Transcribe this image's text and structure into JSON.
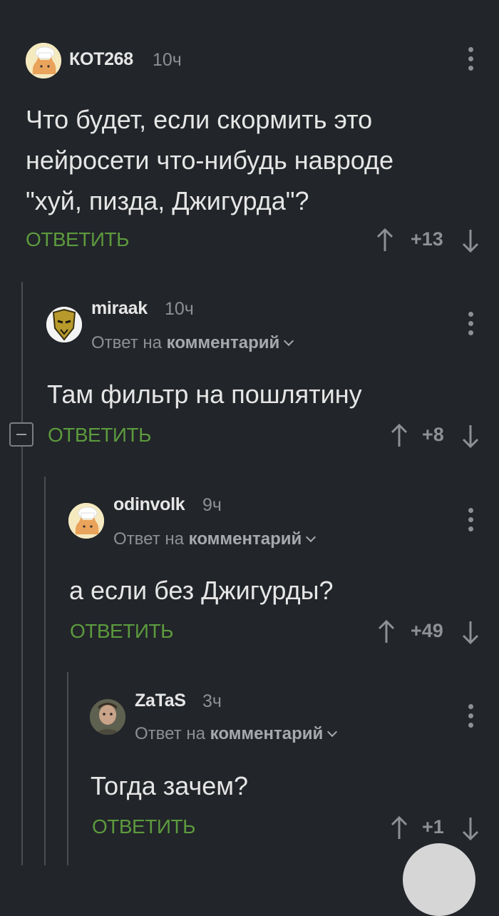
{
  "colors": {
    "background": "#222529",
    "reply_action": "#5c9a3e",
    "muted": "#8d9095",
    "thread_line": "#4a4d52"
  },
  "comments": [
    {
      "username": "КОТ268",
      "time": "10ч",
      "avatar_icon": "cat-chef-avatar-icon",
      "text": "Что будет, если скормить это\nнейросети что-нибудь навроде\n\"хуй, пизда, Джигурда\"?",
      "reply_label": "ОТВЕТИТЬ",
      "score": "+13"
    },
    {
      "username": "miraak",
      "time": "10ч",
      "avatar_icon": "masked-figure-avatar-icon",
      "reply_to_prefix": "Ответ на",
      "reply_to_link": "комментарий",
      "text": "Там фильтр на пошлятину",
      "reply_label": "ОТВЕТИТЬ",
      "score": "+8"
    },
    {
      "username": "odinvolk",
      "time": "9ч",
      "avatar_icon": "cat-chef-avatar-icon",
      "reply_to_prefix": "Ответ на",
      "reply_to_link": "комментарий",
      "text": "а если без Джигурды?",
      "reply_label": "ОТВЕТИТЬ",
      "score": "+49"
    },
    {
      "username": "ZaTaS",
      "time": "3ч",
      "avatar_icon": "user-photo-avatar-icon",
      "reply_to_prefix": "Ответ на",
      "reply_to_link": "комментарий",
      "text": "Тогда зачем?",
      "reply_label": "ОТВЕТИТЬ",
      "score": "+1"
    }
  ]
}
